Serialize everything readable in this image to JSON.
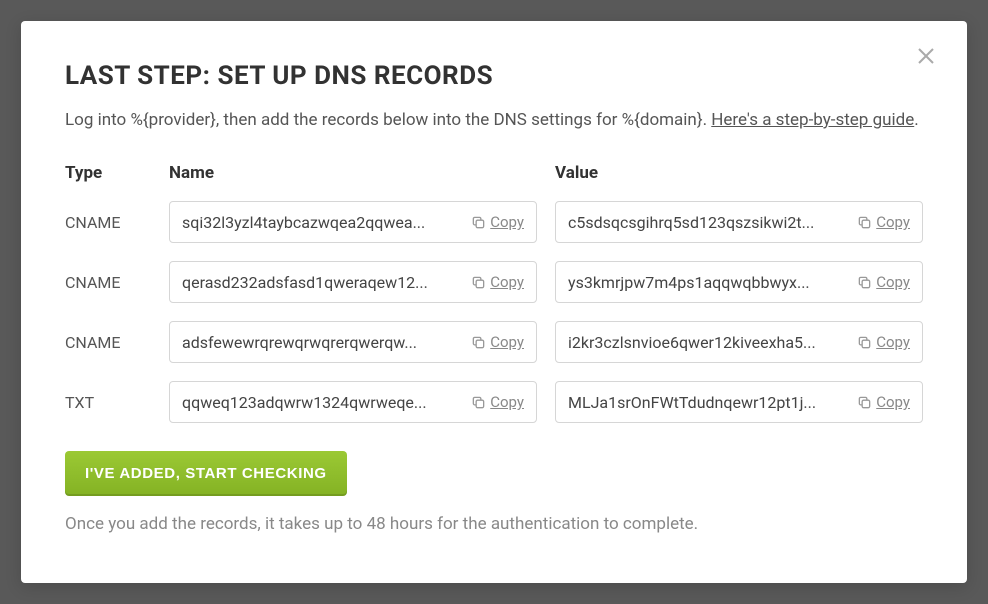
{
  "modal": {
    "title": "LAST STEP: SET UP DNS RECORDS",
    "intro_prefix": "Log into %{provider}, then add the records below into the DNS settings for %{domain}. ",
    "intro_link": "Here's a step-by-step guide",
    "intro_suffix": ".",
    "cta": "I'VE ADDED, START CHECKING",
    "footnote": "Once you add the records, it takes up to 48 hours for the authentication to complete."
  },
  "table": {
    "headers": {
      "type": "Type",
      "name": "Name",
      "value": "Value"
    },
    "copy_label": "Copy",
    "rows": [
      {
        "type": "CNAME",
        "name": "sqi32l3yzl4taybcazwqea2qqwea...",
        "value": "c5sdsqcsgihrq5sd123qszsikwi2t..."
      },
      {
        "type": "CNAME",
        "name": "qerasd232adsfasd1qweraqew12...",
        "value": "ys3kmrjpw7m4ps1aqqwqbbwyx..."
      },
      {
        "type": "CNAME",
        "name": "adsfewewrqrewqrwqrerqwerqw...",
        "value": "i2kr3czlsnvioe6qwer12kiveexha5..."
      },
      {
        "type": "TXT",
        "name": "qqweq123adqwrw1324qwrweqe...",
        "value": "MLJa1srOnFWtTdudnqewr12pt1j..."
      }
    ]
  }
}
